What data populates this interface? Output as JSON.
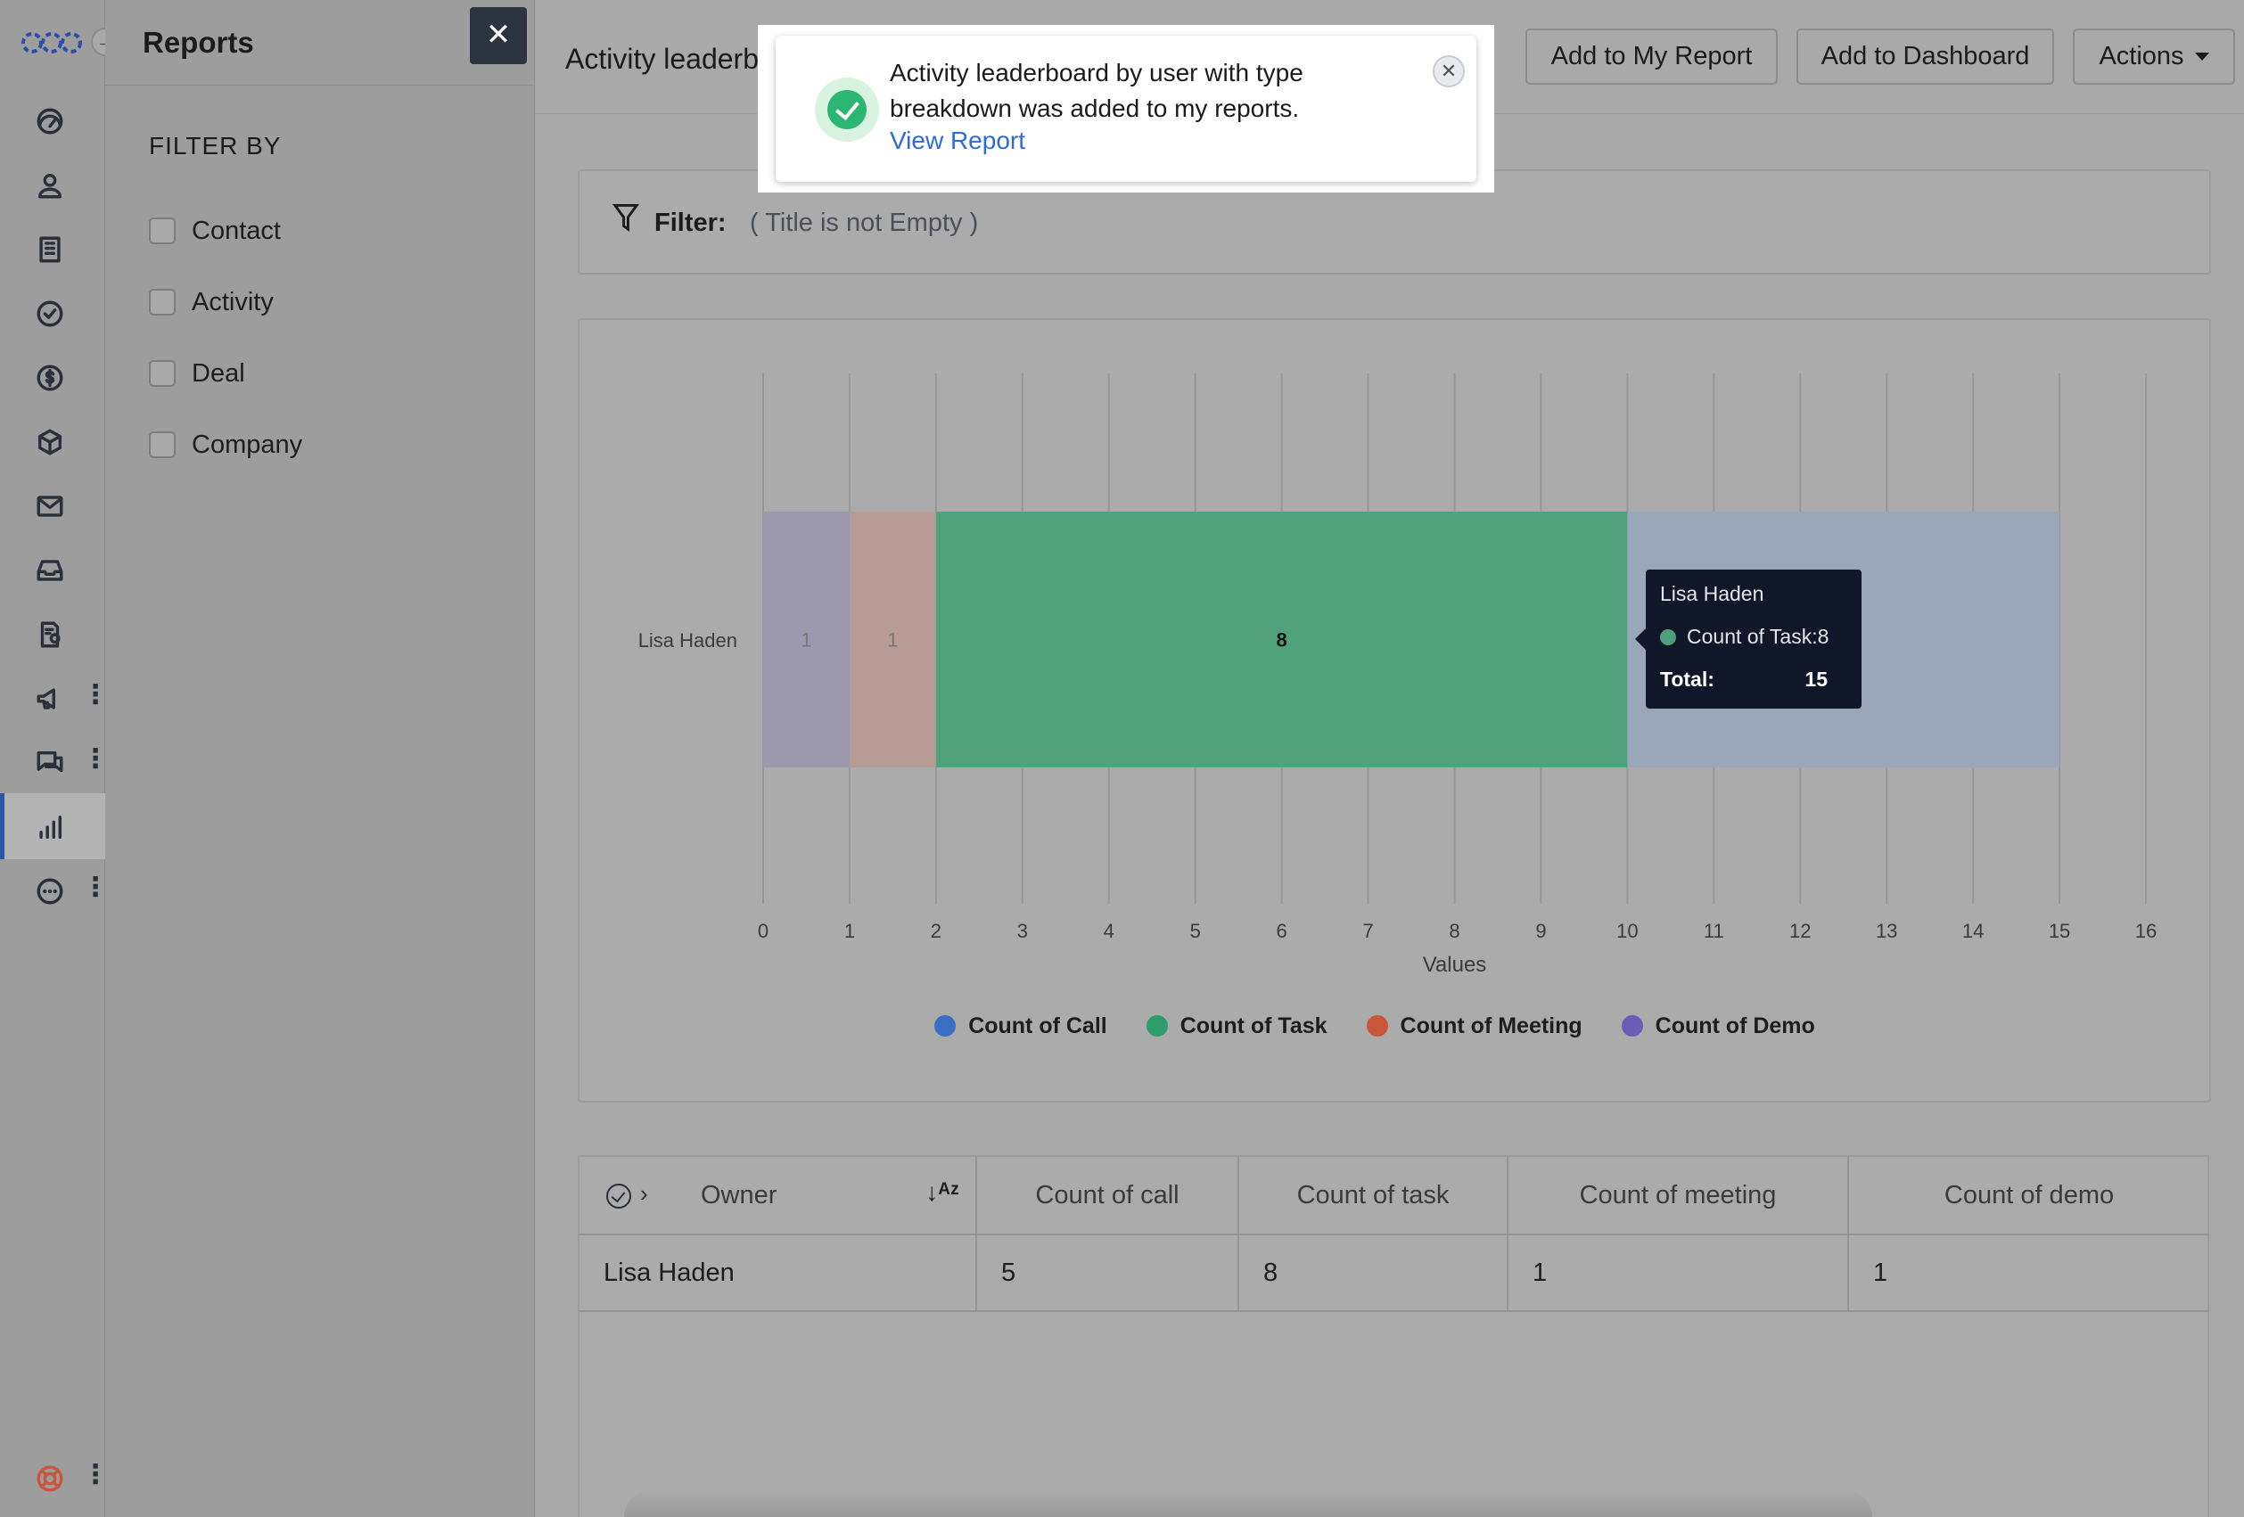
{
  "panel": {
    "title": "Reports",
    "close_glyph": "✕",
    "filter_heading": "FILTER BY",
    "filters": [
      {
        "label": "Contact",
        "checked": false
      },
      {
        "label": "Activity",
        "checked": false
      },
      {
        "label": "Deal",
        "checked": false
      },
      {
        "label": "Company",
        "checked": false
      }
    ]
  },
  "rail": {
    "expand_glyph": "→",
    "icons": [
      "dashboard-icon",
      "contact-icon",
      "company-icon",
      "task-icon",
      "deal-icon",
      "product-icon",
      "mail-icon",
      "inbox-icon",
      "document-icon",
      "campaign-icon",
      "conversation-icon",
      "reports-icon",
      "more-icon",
      "help-icon"
    ],
    "dots": "⋮"
  },
  "header": {
    "title": "Activity leaderboard by user with type breakdown",
    "add_my_report": "Add to My Report",
    "add_dashboard": "Add to Dashboard",
    "actions": "Actions"
  },
  "filter": {
    "label": "Filter:",
    "value": "( Title is not Empty )"
  },
  "toast": {
    "message": "Activity leaderboard by user with type breakdown was added to my reports.",
    "link": "View Report",
    "close_glyph": "✕"
  },
  "tooltip": {
    "name": "Lisa Haden",
    "series_line": "Count of Task:8",
    "total_label": "Total:",
    "total_value": "15"
  },
  "colors": {
    "call": "#3b6fc4",
    "task": "#2f9d6a",
    "meeting": "#c9553a",
    "demo": "#6b5cb5"
  },
  "chart_data": {
    "type": "bar",
    "orientation": "horizontal",
    "stacked": true,
    "categories": [
      "Lisa Haden"
    ],
    "series": [
      {
        "name": "Count of Demo",
        "values": [
          1
        ]
      },
      {
        "name": "Count of Meeting",
        "values": [
          1
        ]
      },
      {
        "name": "Count of Task",
        "values": [
          8
        ]
      },
      {
        "name": "Count of Call",
        "values": [
          5
        ]
      }
    ],
    "data_labels": [
      "1",
      "1",
      "8"
    ],
    "xlabel": "Values",
    "ylabel": "",
    "xlim": [
      0,
      16
    ],
    "xticks": [
      "0",
      "1",
      "2",
      "3",
      "4",
      "5",
      "6",
      "7",
      "8",
      "9",
      "10",
      "11",
      "12",
      "13",
      "14",
      "15",
      "16"
    ],
    "grid": true,
    "legend_position": "bottom",
    "legend": [
      "Count of Call",
      "Count of Task",
      "Count of Meeting",
      "Count of Demo"
    ]
  },
  "table": {
    "headers": [
      "Owner",
      "Count of call",
      "Count of task",
      "Count of meeting",
      "Count of demo"
    ],
    "sort_glyph": "↓ᴬᶻ",
    "expand_glyph": "›",
    "rows": [
      [
        "Lisa Haden",
        "5",
        "8",
        "1",
        "1"
      ]
    ]
  }
}
